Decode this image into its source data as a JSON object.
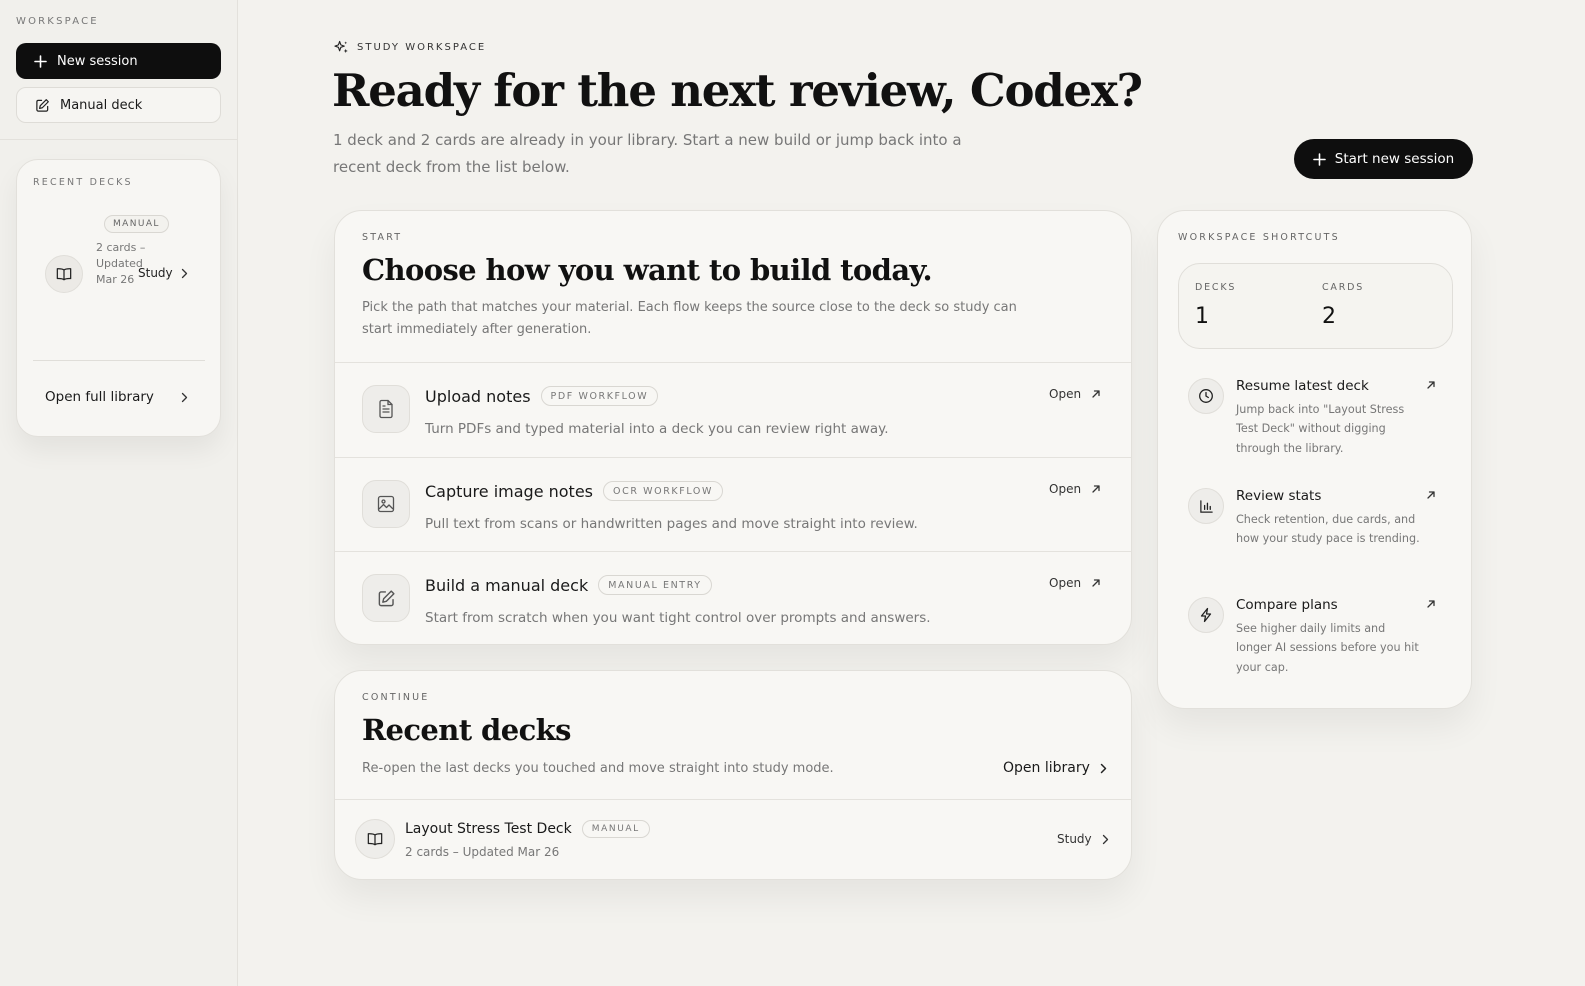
{
  "sidebar": {
    "section_label": "WORKSPACE",
    "new_session_label": "New session",
    "manual_deck_label": "Manual deck",
    "recent": {
      "label": "RECENT DECKS",
      "badge": "MANUAL",
      "meta": "2 cards – Updated Mar 26",
      "study_label": "Study",
      "open_library_label": "Open full library"
    }
  },
  "header": {
    "eyebrow": "STUDY WORKSPACE",
    "title": "Ready for the next review, Codex?",
    "subtitle": "1 deck and 2 cards are already in your library. Start a new build or jump back into a recent deck from the list below.",
    "start_button": "Start new session"
  },
  "build": {
    "eyebrow": "START",
    "title": "Choose how you want to build today.",
    "subtitle": "Pick the path that matches your material. Each flow keeps the source close to the deck so study can start immediately after generation.",
    "flows": [
      {
        "title": "Upload notes",
        "badge": "PDF WORKFLOW",
        "desc": "Turn PDFs and typed material into a deck you can review right away.",
        "action": "Open",
        "icon": "document-icon"
      },
      {
        "title": "Capture image notes",
        "badge": "OCR WORKFLOW",
        "desc": "Pull text from scans or handwritten pages and move straight into review.",
        "action": "Open",
        "icon": "image-icon"
      },
      {
        "title": "Build a manual deck",
        "badge": "MANUAL ENTRY",
        "desc": "Start from scratch when you want tight control over prompts and answers.",
        "action": "Open",
        "icon": "edit-icon"
      }
    ]
  },
  "continue": {
    "eyebrow": "CONTINUE",
    "title": "Recent decks",
    "subtitle": "Re-open the last decks you touched and move straight into study mode.",
    "open_library": "Open library",
    "deck": {
      "title": "Layout Stress Test Deck",
      "badge": "MANUAL",
      "meta": "2 cards – Updated Mar 26",
      "action": "Study"
    }
  },
  "shortcuts": {
    "label": "WORKSPACE SHORTCUTS",
    "stats": [
      {
        "label": "DECKS",
        "value": "1"
      },
      {
        "label": "CARDS",
        "value": "2"
      }
    ],
    "items": [
      {
        "title": "Resume latest deck",
        "desc": "Jump back into \"Layout Stress Test Deck\" without digging through the library.",
        "icon": "clock-icon"
      },
      {
        "title": "Review stats",
        "desc": "Check retention, due cards, and how your study pace is trending.",
        "icon": "bar-chart-icon"
      },
      {
        "title": "Compare plans",
        "desc": "See higher daily limits and longer AI sessions before you hit your cap.",
        "icon": "lightning-icon"
      }
    ]
  }
}
